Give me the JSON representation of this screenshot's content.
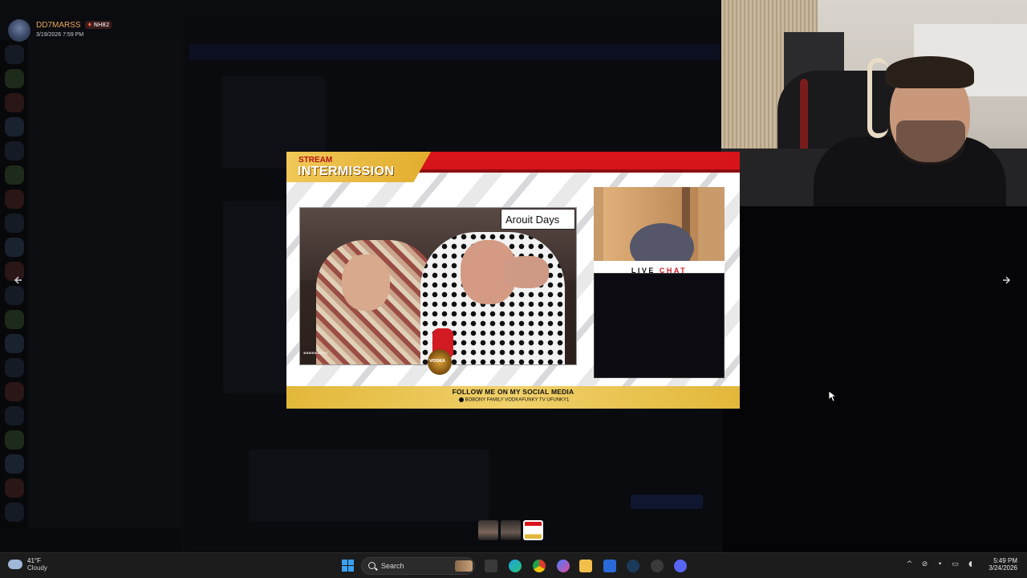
{
  "message": {
    "author": "DD7MARSS",
    "badge": "NH82",
    "timestamp": "3/19/2026 7:59 PM"
  },
  "viewer": {
    "stream_label_small": "STREAM",
    "stream_label_big": "INTERMISSION",
    "video_caption": "Arouit Days",
    "live_chat_part1": "LIVE ",
    "live_chat_part2": "CHAT",
    "footer_main": "FOLLOW ME ON MY SOCIAL MEDIA",
    "footer_sub": "BOBONY FAMILY   VODKAFUNKY TV   UFUNKY1",
    "vodka_logo_text": "VODKA"
  },
  "navigation": {
    "prev_icon": "arrow-left",
    "next_icon": "arrow-right"
  },
  "thumbnails": [
    "thumb-1",
    "thumb-2",
    "thumb-3-selected"
  ],
  "taskbar": {
    "weather_temp": "41°F",
    "weather_condition": "Cloudy",
    "search_label": "Search",
    "time": "5:49 PM",
    "date": "3/24/2026"
  },
  "colors": {
    "author_name": "#e9a75a",
    "intermission_red": "#d7141a",
    "intermission_gold": "#e2b83a",
    "taskbar_bg": "#1c1c1c"
  }
}
